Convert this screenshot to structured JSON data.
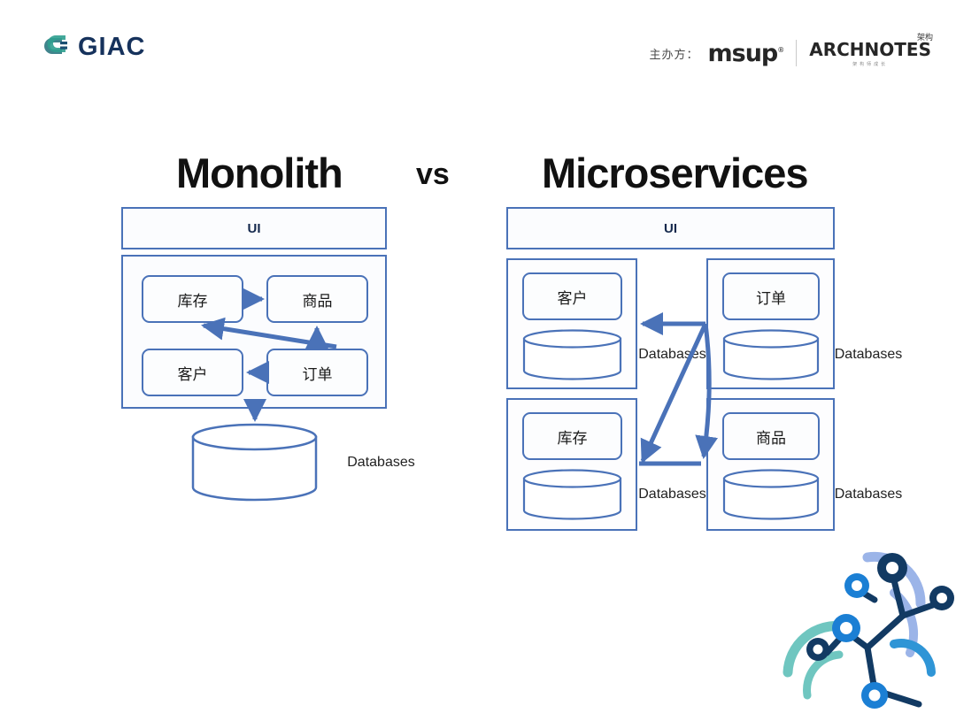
{
  "brand": {
    "giac": "GIAC",
    "sponsor_label": "主办方：",
    "msup": "msup",
    "msup_mark": "®",
    "archnotes_main": "ARCHNOTES",
    "archnotes_cn": "架构",
    "archnotes_sub": "架构师成长"
  },
  "title": {
    "left": "Monolith",
    "middle": "vs",
    "right": "Microservices"
  },
  "colors": {
    "stroke_blue": "#4a72b8",
    "box_fill": "#fbfcfe",
    "title_black": "#111111",
    "ui_text": "#15294d",
    "deco_navy": "#123a63",
    "deco_blue": "#1b7fd4",
    "deco_teal": "#6fc6c0",
    "deco_lilac": "#9bb4e8"
  },
  "monolith": {
    "ui_label": "UI",
    "modules": [
      {
        "label": "库存"
      },
      {
        "label": "商品"
      },
      {
        "label": "客户"
      },
      {
        "label": "订单"
      }
    ],
    "database_label": "Databases",
    "arrows": [
      {
        "from": "库存",
        "to": "商品"
      },
      {
        "from": "订单",
        "to": "库存"
      },
      {
        "from": "订单",
        "to": "商品"
      },
      {
        "from": "订单",
        "to": "客户"
      },
      {
        "from": "container",
        "to": "Databases"
      }
    ]
  },
  "microservices": {
    "ui_label": "UI",
    "services": [
      {
        "label": "客户",
        "database_label": "Databases"
      },
      {
        "label": "订单",
        "database_label": "Databases"
      },
      {
        "label": "库存",
        "database_label": "Databases"
      },
      {
        "label": "商品",
        "database_label": "Databases"
      }
    ],
    "arrows": [
      {
        "from": "订单",
        "to": "客户"
      },
      {
        "from": "订单",
        "to": "库存"
      },
      {
        "from": "订单",
        "to": "商品"
      }
    ]
  }
}
